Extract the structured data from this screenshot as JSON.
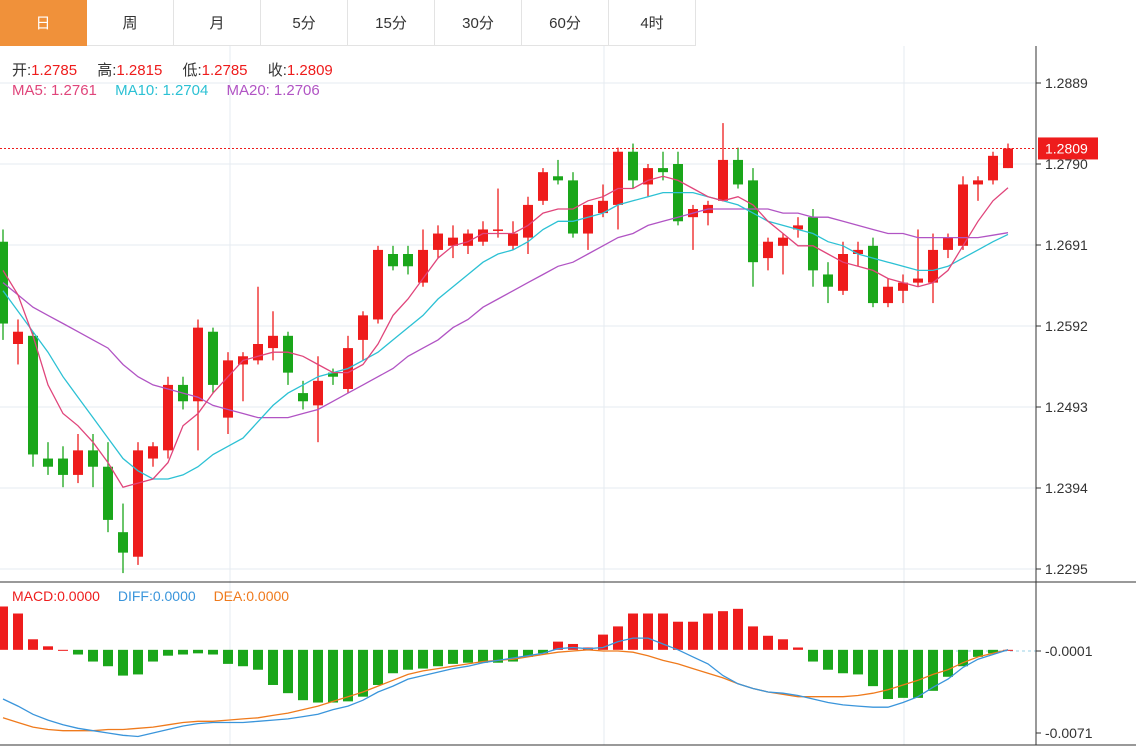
{
  "tabs": [
    "日",
    "周",
    "月",
    "5分",
    "15分",
    "30分",
    "60分",
    "4时"
  ],
  "active_tab": 0,
  "colors": {
    "up": "#ee1c1c",
    "down": "#1aa61a",
    "ma5": "#e0457b",
    "ma10": "#2cc1d4",
    "ma20": "#b154c4",
    "diff": "#3a95db",
    "dea": "#ef7a1c",
    "active_tab": "#f0913a",
    "last_price": "#ee1c1c"
  },
  "ohlc_legend": {
    "open_label": "开:",
    "open": "1.2785",
    "high_label": "高:",
    "high": "1.2815",
    "low_label": "低:",
    "low": "1.2785",
    "close_label": "收:",
    "close": "1.2809"
  },
  "ma_legend": {
    "ma5_label": "MA5:",
    "ma5": "1.2761",
    "ma10_label": "MA10:",
    "ma10": "1.2704",
    "ma20_label": "MA20:",
    "ma20": "1.2706"
  },
  "macd_legend": {
    "macd_label": "MACD:",
    "macd": "0.0000",
    "diff_label": "DIFF:",
    "diff": "0.0000",
    "dea_label": "DEA:",
    "dea": "0.0000"
  },
  "chart_data": [
    {
      "type": "candlestick",
      "price_axis": {
        "ticks": [
          "1.2889",
          "1.2790",
          "1.2691",
          "1.2592",
          "1.2493",
          "1.2394",
          "1.2295"
        ],
        "range": [
          1.2285,
          1.2929
        ]
      },
      "last_price_label": "1.2809",
      "last_price": 1.2809,
      "candles": [
        [
          1.2695,
          1.271,
          1.2575,
          1.2595
        ],
        [
          1.257,
          1.26,
          1.2545,
          1.2585
        ],
        [
          1.258,
          1.2585,
          1.242,
          1.2435
        ],
        [
          1.243,
          1.245,
          1.241,
          1.242
        ],
        [
          1.243,
          1.2445,
          1.2395,
          1.241
        ],
        [
          1.241,
          1.246,
          1.24,
          1.244
        ],
        [
          1.244,
          1.246,
          1.2395,
          1.242
        ],
        [
          1.242,
          1.245,
          1.234,
          1.2355
        ],
        [
          1.234,
          1.2375,
          1.229,
          1.2315
        ],
        [
          1.231,
          1.245,
          1.23,
          1.244
        ],
        [
          1.243,
          1.245,
          1.242,
          1.2445
        ],
        [
          1.244,
          1.253,
          1.243,
          1.252
        ],
        [
          1.252,
          1.253,
          1.249,
          1.25
        ],
        [
          1.25,
          1.26,
          1.244,
          1.259
        ],
        [
          1.2585,
          1.259,
          1.251,
          1.252
        ],
        [
          1.248,
          1.256,
          1.246,
          1.255
        ],
        [
          1.2545,
          1.256,
          1.25,
          1.2555
        ],
        [
          1.255,
          1.264,
          1.2545,
          1.257
        ],
        [
          1.2565,
          1.261,
          1.255,
          1.258
        ],
        [
          1.258,
          1.2585,
          1.252,
          1.2535
        ],
        [
          1.251,
          1.2525,
          1.249,
          1.25
        ],
        [
          1.2495,
          1.2555,
          1.245,
          1.2525
        ],
        [
          1.2535,
          1.254,
          1.252,
          1.253
        ],
        [
          1.2515,
          1.258,
          1.251,
          1.2565
        ],
        [
          1.2575,
          1.261,
          1.255,
          1.2605
        ],
        [
          1.26,
          1.269,
          1.2595,
          1.2685
        ],
        [
          1.268,
          1.269,
          1.266,
          1.2665
        ],
        [
          1.268,
          1.269,
          1.2655,
          1.2665
        ],
        [
          1.2645,
          1.271,
          1.264,
          1.2685
        ],
        [
          1.2685,
          1.2715,
          1.2675,
          1.2705
        ],
        [
          1.269,
          1.2715,
          1.2675,
          1.27
        ],
        [
          1.269,
          1.271,
          1.268,
          1.2705
        ],
        [
          1.2695,
          1.272,
          1.269,
          1.271
        ],
        [
          1.271,
          1.276,
          1.27,
          1.271
        ],
        [
          1.269,
          1.272,
          1.2685,
          1.2705
        ],
        [
          1.27,
          1.275,
          1.268,
          1.274
        ],
        [
          1.2745,
          1.2785,
          1.274,
          1.278
        ],
        [
          1.2775,
          1.2795,
          1.2765,
          1.277
        ],
        [
          1.277,
          1.278,
          1.27,
          1.2705
        ],
        [
          1.2705,
          1.274,
          1.2685,
          1.274
        ],
        [
          1.273,
          1.2765,
          1.2725,
          1.2745
        ],
        [
          1.274,
          1.281,
          1.271,
          1.2805
        ],
        [
          1.2805,
          1.2815,
          1.276,
          1.277
        ],
        [
          1.2765,
          1.279,
          1.275,
          1.2785
        ],
        [
          1.2785,
          1.2805,
          1.277,
          1.278
        ],
        [
          1.279,
          1.2805,
          1.2715,
          1.272
        ],
        [
          1.2725,
          1.274,
          1.2685,
          1.2735
        ],
        [
          1.273,
          1.2745,
          1.2715,
          1.274
        ],
        [
          1.2745,
          1.284,
          1.2745,
          1.2795
        ],
        [
          1.2795,
          1.281,
          1.276,
          1.2765
        ],
        [
          1.277,
          1.2785,
          1.264,
          1.267
        ],
        [
          1.2675,
          1.27,
          1.266,
          1.2695
        ],
        [
          1.269,
          1.2705,
          1.2655,
          1.27
        ],
        [
          1.271,
          1.2725,
          1.27,
          1.2715
        ],
        [
          1.2725,
          1.2735,
          1.264,
          1.266
        ],
        [
          1.2655,
          1.267,
          1.262,
          1.264
        ],
        [
          1.2635,
          1.2695,
          1.263,
          1.268
        ],
        [
          1.268,
          1.2695,
          1.2665,
          1.2685
        ],
        [
          1.269,
          1.27,
          1.2615,
          1.262
        ],
        [
          1.262,
          1.265,
          1.2615,
          1.264
        ],
        [
          1.2635,
          1.2655,
          1.262,
          1.2645
        ],
        [
          1.2645,
          1.271,
          1.264,
          1.265
        ],
        [
          1.2645,
          1.2705,
          1.262,
          1.2685
        ],
        [
          1.2685,
          1.2705,
          1.2675,
          1.27
        ],
        [
          1.269,
          1.2775,
          1.2685,
          1.2765
        ],
        [
          1.2765,
          1.2775,
          1.2745,
          1.277
        ],
        [
          1.277,
          1.2805,
          1.2765,
          1.28
        ],
        [
          1.2785,
          1.2815,
          1.2785,
          1.2809
        ]
      ],
      "ma5": [
        1.266,
        1.263,
        1.258,
        1.252,
        1.2485,
        1.247,
        1.245,
        1.2425,
        1.2395,
        1.24,
        1.2405,
        1.2425,
        1.247,
        1.2485,
        1.251,
        1.253,
        1.255,
        1.2555,
        1.256,
        1.256,
        1.2555,
        1.2545,
        1.2535,
        1.2535,
        1.2545,
        1.257,
        1.2605,
        1.2625,
        1.265,
        1.2675,
        1.269,
        1.2695,
        1.2705,
        1.2705,
        1.2705,
        1.2715,
        1.273,
        1.2735,
        1.2735,
        1.2745,
        1.275,
        1.276,
        1.276,
        1.277,
        1.2775,
        1.277,
        1.276,
        1.275,
        1.2745,
        1.275,
        1.274,
        1.272,
        1.2705,
        1.269,
        1.269,
        1.268,
        1.267,
        1.2665,
        1.266,
        1.265,
        1.2645,
        1.264,
        1.2645,
        1.266,
        1.269,
        1.272,
        1.2745,
        1.2761
      ],
      "ma10": [
        1.2635,
        1.261,
        1.2585,
        1.256,
        1.253,
        1.2505,
        1.248,
        1.2455,
        1.243,
        1.2415,
        1.2405,
        1.2405,
        1.241,
        1.242,
        1.2435,
        1.2445,
        1.2455,
        1.2475,
        1.2495,
        1.251,
        1.252,
        1.253,
        1.2535,
        1.254,
        1.255,
        1.256,
        1.2575,
        1.259,
        1.2605,
        1.2625,
        1.264,
        1.2655,
        1.267,
        1.268,
        1.2685,
        1.2695,
        1.271,
        1.272,
        1.272,
        1.2725,
        1.273,
        1.274,
        1.2745,
        1.275,
        1.2755,
        1.2755,
        1.2755,
        1.275,
        1.2745,
        1.274,
        1.273,
        1.272,
        1.2715,
        1.271,
        1.2705,
        1.2695,
        1.269,
        1.268,
        1.2675,
        1.267,
        1.2665,
        1.266,
        1.266,
        1.2665,
        1.2675,
        1.2685,
        1.2695,
        1.2704
      ],
      "ma20": [
        1.2645,
        1.263,
        1.2615,
        1.2605,
        1.2595,
        1.2585,
        1.2575,
        1.2565,
        1.2545,
        1.253,
        1.252,
        1.2515,
        1.251,
        1.2505,
        1.2495,
        1.249,
        1.2485,
        1.248,
        1.248,
        1.248,
        1.2485,
        1.249,
        1.25,
        1.251,
        1.252,
        1.253,
        1.254,
        1.2555,
        1.2565,
        1.2575,
        1.259,
        1.26,
        1.2615,
        1.2625,
        1.2635,
        1.2645,
        1.2655,
        1.2665,
        1.267,
        1.268,
        1.269,
        1.27,
        1.2705,
        1.2715,
        1.272,
        1.2725,
        1.273,
        1.2735,
        1.2735,
        1.2735,
        1.2735,
        1.2735,
        1.273,
        1.273,
        1.2725,
        1.2725,
        1.272,
        1.2715,
        1.271,
        1.2705,
        1.2705,
        1.27,
        1.27,
        1.27,
        1.27,
        1.27,
        1.2703,
        1.2706
      ]
    },
    {
      "type": "bar",
      "indicator": "MACD",
      "value_axis": {
        "ticks": [
          "-0.0001",
          "-0.0071"
        ],
        "range": [
          -0.008,
          0.0042
        ]
      },
      "macd": [
        0.0037,
        0.0031,
        0.0009,
        0.0003,
        0.0,
        -0.0004,
        -0.001,
        -0.0014,
        -0.0022,
        -0.0021,
        -0.001,
        -0.0005,
        -0.0004,
        -0.0003,
        -0.0004,
        -0.0012,
        -0.0014,
        -0.0017,
        -0.003,
        -0.0037,
        -0.0043,
        -0.0045,
        -0.0045,
        -0.0044,
        -0.004,
        -0.003,
        -0.002,
        -0.0017,
        -0.0016,
        -0.0014,
        -0.0012,
        -0.0011,
        -0.0011,
        -0.0011,
        -0.001,
        -0.0006,
        -0.0003,
        0.0007,
        0.0005,
        0.0002,
        0.0013,
        0.002,
        0.0031,
        0.0031,
        0.0031,
        0.0024,
        0.0024,
        0.0031,
        0.0033,
        0.0035,
        0.002,
        0.0012,
        0.0009,
        0.0002,
        -0.001,
        -0.0017,
        -0.002,
        -0.0021,
        -0.0031,
        -0.0042,
        -0.0041,
        -0.0041,
        -0.0035,
        -0.0023,
        -0.0014,
        -0.0006,
        -0.0003,
        0.0
      ],
      "diff": [
        -0.0042,
        -0.0048,
        -0.0055,
        -0.006,
        -0.0064,
        -0.0067,
        -0.0069,
        -0.0071,
        -0.0073,
        -0.0074,
        -0.0071,
        -0.0068,
        -0.0065,
        -0.0063,
        -0.0062,
        -0.0062,
        -0.0062,
        -0.0061,
        -0.006,
        -0.0059,
        -0.0057,
        -0.0055,
        -0.0051,
        -0.0048,
        -0.0043,
        -0.0036,
        -0.0031,
        -0.0025,
        -0.0022,
        -0.0019,
        -0.0016,
        -0.0014,
        -0.0011,
        -0.0009,
        -0.0007,
        -0.0005,
        -0.0003,
        0.0001,
        0.0002,
        0.0001,
        0.0002,
        0.0007,
        0.001,
        0.001,
        0.0005,
        0.0,
        -0.0006,
        -0.0012,
        -0.0022,
        -0.0029,
        -0.0033,
        -0.0036,
        -0.0037,
        -0.0039,
        -0.0042,
        -0.0045,
        -0.0047,
        -0.0048,
        -0.0049,
        -0.0049,
        -0.0045,
        -0.004,
        -0.0032,
        -0.0025,
        -0.0015,
        -0.0008,
        -0.0004,
        0.0
      ],
      "dea": [
        -0.0058,
        -0.0062,
        -0.0066,
        -0.0068,
        -0.0069,
        -0.0069,
        -0.0069,
        -0.0068,
        -0.0068,
        -0.0067,
        -0.0066,
        -0.0064,
        -0.0062,
        -0.0061,
        -0.0061,
        -0.006,
        -0.0059,
        -0.0058,
        -0.0056,
        -0.0054,
        -0.0051,
        -0.0048,
        -0.0044,
        -0.004,
        -0.0036,
        -0.0031,
        -0.0026,
        -0.0021,
        -0.0018,
        -0.0016,
        -0.0014,
        -0.0012,
        -0.001,
        -0.0009,
        -0.0008,
        -0.0006,
        -0.0004,
        -0.0002,
        -0.0001,
        0.0,
        -0.0001,
        -0.0001,
        -0.0002,
        -0.0005,
        -0.0009,
        -0.0012,
        -0.0016,
        -0.002,
        -0.0024,
        -0.0029,
        -0.0033,
        -0.0036,
        -0.0038,
        -0.004,
        -0.004,
        -0.004,
        -0.004,
        -0.0039,
        -0.0037,
        -0.0034,
        -0.003,
        -0.0026,
        -0.0021,
        -0.0017,
        -0.0011,
        -0.0006,
        -0.0003,
        0.0
      ]
    }
  ]
}
